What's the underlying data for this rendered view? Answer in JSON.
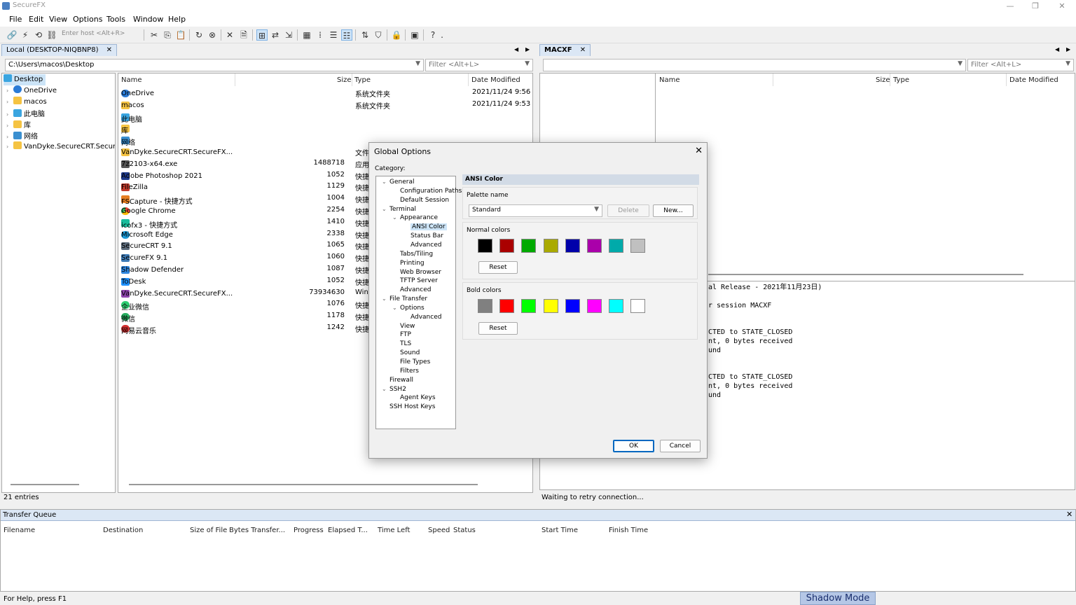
{
  "app": {
    "title": "SecureFX"
  },
  "menu": [
    "File",
    "Edit",
    "View",
    "Options",
    "Tools",
    "Window",
    "Help"
  ],
  "toolbar": {
    "host_placeholder": "Enter host <Alt+R>"
  },
  "local": {
    "tab": "Local (DESKTOP-NIQBNP8)",
    "path": "C:\\Users\\macos\\Desktop",
    "filter": "Filter <Alt+L>",
    "tree": [
      {
        "label": "Desktop",
        "icon": "desktop-icon",
        "selected": true
      },
      {
        "label": "OneDrive",
        "icon": "cloud-icon"
      },
      {
        "label": "macos",
        "icon": "folder-icon"
      },
      {
        "label": "此电脑",
        "icon": "computer-icon"
      },
      {
        "label": "库",
        "icon": "folder-icon"
      },
      {
        "label": "网络",
        "icon": "network-icon"
      },
      {
        "label": "VanDyke.SecureCRT.Secure",
        "icon": "folder-icon"
      }
    ],
    "columns": {
      "name": "Name",
      "size": "Size",
      "type": "Type",
      "date": "Date Modified"
    },
    "files": [
      {
        "name": "OneDrive",
        "size": "",
        "type": "系统文件夹",
        "date": "2021/11/24 9:56",
        "icon": "cloud"
      },
      {
        "name": "macos",
        "size": "",
        "type": "系统文件夹",
        "date": "2021/11/24 9:53",
        "icon": "folder"
      },
      {
        "name": "此电脑",
        "size": "",
        "type": "",
        "date": "",
        "icon": "pc"
      },
      {
        "name": "库",
        "size": "",
        "type": "",
        "date": "",
        "icon": "folder"
      },
      {
        "name": "网络",
        "size": "",
        "type": "",
        "date": "",
        "icon": "net"
      },
      {
        "name": "VanDyke.SecureCRT.SecureFX...",
        "size": "",
        "type": "文件",
        "date": "",
        "icon": "folder"
      },
      {
        "name": "7z2103-x64.exe",
        "size": "1488718",
        "type": "应用",
        "date": "",
        "icon": "exe"
      },
      {
        "name": "Adobe Photoshop 2021",
        "size": "1052",
        "type": "快捷",
        "date": "",
        "icon": "ps"
      },
      {
        "name": "FileZilla",
        "size": "1129",
        "type": "快捷",
        "date": "",
        "icon": "fz"
      },
      {
        "name": "FSCapture - 快捷方式",
        "size": "1004",
        "type": "快捷",
        "date": "",
        "icon": "fs"
      },
      {
        "name": "Google Chrome",
        "size": "2254",
        "type": "快捷",
        "date": "",
        "icon": "gc"
      },
      {
        "name": "icofx3 - 快捷方式",
        "size": "1410",
        "type": "快捷",
        "date": "",
        "icon": "ico"
      },
      {
        "name": "Microsoft Edge",
        "size": "2338",
        "type": "快捷",
        "date": "",
        "icon": "edge"
      },
      {
        "name": "SecureCRT 9.1",
        "size": "1065",
        "type": "快捷",
        "date": "",
        "icon": "scrt"
      },
      {
        "name": "SecureFX 9.1",
        "size": "1060",
        "type": "快捷",
        "date": "",
        "icon": "sfx"
      },
      {
        "name": "Shadow Defender",
        "size": "1087",
        "type": "快捷",
        "date": "",
        "icon": "sd"
      },
      {
        "name": "ToDesk",
        "size": "1052",
        "type": "快捷",
        "date": "",
        "icon": "td"
      },
      {
        "name": "VanDyke.SecureCRT.SecureFX...",
        "size": "73934630",
        "type": "Win",
        "date": "",
        "icon": "vd"
      },
      {
        "name": "企业微信",
        "size": "1076",
        "type": "快捷",
        "date": "",
        "icon": "wx"
      },
      {
        "name": "微信",
        "size": "1178",
        "type": "快捷",
        "date": "",
        "icon": "wc"
      },
      {
        "name": "网易云音乐",
        "size": "1242",
        "type": "快捷",
        "date": "",
        "icon": "wy"
      }
    ],
    "status": "21 entries"
  },
  "remote": {
    "tab": "MACXF",
    "filter": "Filter <Alt+L>",
    "columns": {
      "name": "Name",
      "size": "Size",
      "type": "Type",
      "date": "Date Modified"
    },
    "log": [
      "al Release - 2021年11月23日)",
      "",
      "r session MACXF",
      "",
      "",
      "CTED to STATE_CLOSED",
      "nt, 0 bytes received",
      "und",
      "",
      "",
      "CTED to STATE_CLOSED",
      "nt, 0 bytes received",
      "und"
    ],
    "status": "Waiting to retry connection..."
  },
  "queue": {
    "title": "Transfer Queue",
    "columns": [
      "Filename",
      "Destination",
      "Size of File",
      "Bytes Transfer...",
      "Progress",
      "Elapsed T...",
      "Time Left",
      "Speed",
      "Status",
      "Start Time",
      "Finish Time"
    ]
  },
  "statusbar": {
    "help": "For Help, press F1",
    "shadow_mode": "Shadow Mode"
  },
  "dialog": {
    "title": "Global Options",
    "category_label": "Category:",
    "tree": [
      {
        "label": "General",
        "level": 0,
        "expanded": true
      },
      {
        "label": "Configuration Paths",
        "level": 1
      },
      {
        "label": "Default Session",
        "level": 1
      },
      {
        "label": "Terminal",
        "level": 0,
        "expanded": true
      },
      {
        "label": "Appearance",
        "level": 1,
        "expanded": true
      },
      {
        "label": "ANSI Color",
        "level": 2,
        "selected": true
      },
      {
        "label": "Status Bar",
        "level": 2
      },
      {
        "label": "Advanced",
        "level": 2
      },
      {
        "label": "Tabs/Tiling",
        "level": 1
      },
      {
        "label": "Printing",
        "level": 1
      },
      {
        "label": "Web Browser",
        "level": 1
      },
      {
        "label": "TFTP Server",
        "level": 1
      },
      {
        "label": "Advanced",
        "level": 1
      },
      {
        "label": "File Transfer",
        "level": 0,
        "expanded": true
      },
      {
        "label": "Options",
        "level": 1,
        "expanded": true
      },
      {
        "label": "Advanced",
        "level": 2
      },
      {
        "label": "View",
        "level": 1
      },
      {
        "label": "FTP",
        "level": 1
      },
      {
        "label": "TLS",
        "level": 1
      },
      {
        "label": "Sound",
        "level": 1
      },
      {
        "label": "File Types",
        "level": 1
      },
      {
        "label": "Filters",
        "level": 1
      },
      {
        "label": "Firewall",
        "level": 0
      },
      {
        "label": "SSH2",
        "level": 0,
        "expanded": true
      },
      {
        "label": "Agent Keys",
        "level": 1
      },
      {
        "label": "SSH Host Keys",
        "level": 0
      }
    ],
    "section_title": "ANSI Color",
    "palette_label": "Palette name",
    "palette_value": "Standard",
    "delete_label": "Delete",
    "new_label": "New...",
    "normal_label": "Normal colors",
    "normal_colors": [
      "#000000",
      "#aa0000",
      "#00aa00",
      "#aaaa00",
      "#0000aa",
      "#aa00aa",
      "#00aaaa",
      "#c0c0c0"
    ],
    "bold_label": "Bold colors",
    "bold_colors": [
      "#808080",
      "#ff0000",
      "#00ff00",
      "#ffff00",
      "#0000ff",
      "#ff00ff",
      "#00ffff",
      "#ffffff"
    ],
    "reset_label": "Reset",
    "ok_label": "OK",
    "cancel_label": "Cancel"
  }
}
